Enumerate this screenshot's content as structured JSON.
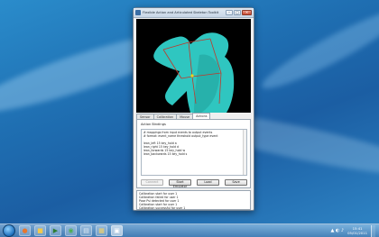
{
  "window": {
    "title": "Flexible Action and Articulated Skeleton Toolkit"
  },
  "tabs": [
    {
      "label": "Sensor"
    },
    {
      "label": "Calibration"
    },
    {
      "label": "Mouse"
    },
    {
      "label": "Actions"
    }
  ],
  "actions_panel": {
    "heading": "Action Bindings",
    "binding_lines": [
      "# mappings from input events to output events",
      "# format: event_name threshold output_type event",
      "",
      "lean_left 15 key_hold a",
      "lean_right 15 key_hold d",
      "lean_forwards 15 key_hold w",
      "lean_backwards 15 key_hold s"
    ],
    "buttons": {
      "connect": "Connect",
      "start_emulator": "Start Emulator",
      "load": "Load",
      "save": "Save"
    }
  },
  "log": {
    "lines": [
      "Calibration start for user 1",
      "Calibration failed for user 1",
      "Pose Psi detected for user 1",
      "Calibration start for user 1",
      "Calibration successful for user 1"
    ]
  },
  "taskbar": {
    "icons": [
      "start-orb",
      "firefox",
      "folder",
      "media-player",
      "chrome",
      "notepad",
      "explorer",
      "toolkit-app"
    ],
    "time": "15:41",
    "date": "05/01/2011"
  },
  "colors": {
    "depth_silhouette": "#2fc6c0",
    "skeleton_lines": "#c0392b",
    "skeleton_joint": "#f1d21a"
  }
}
